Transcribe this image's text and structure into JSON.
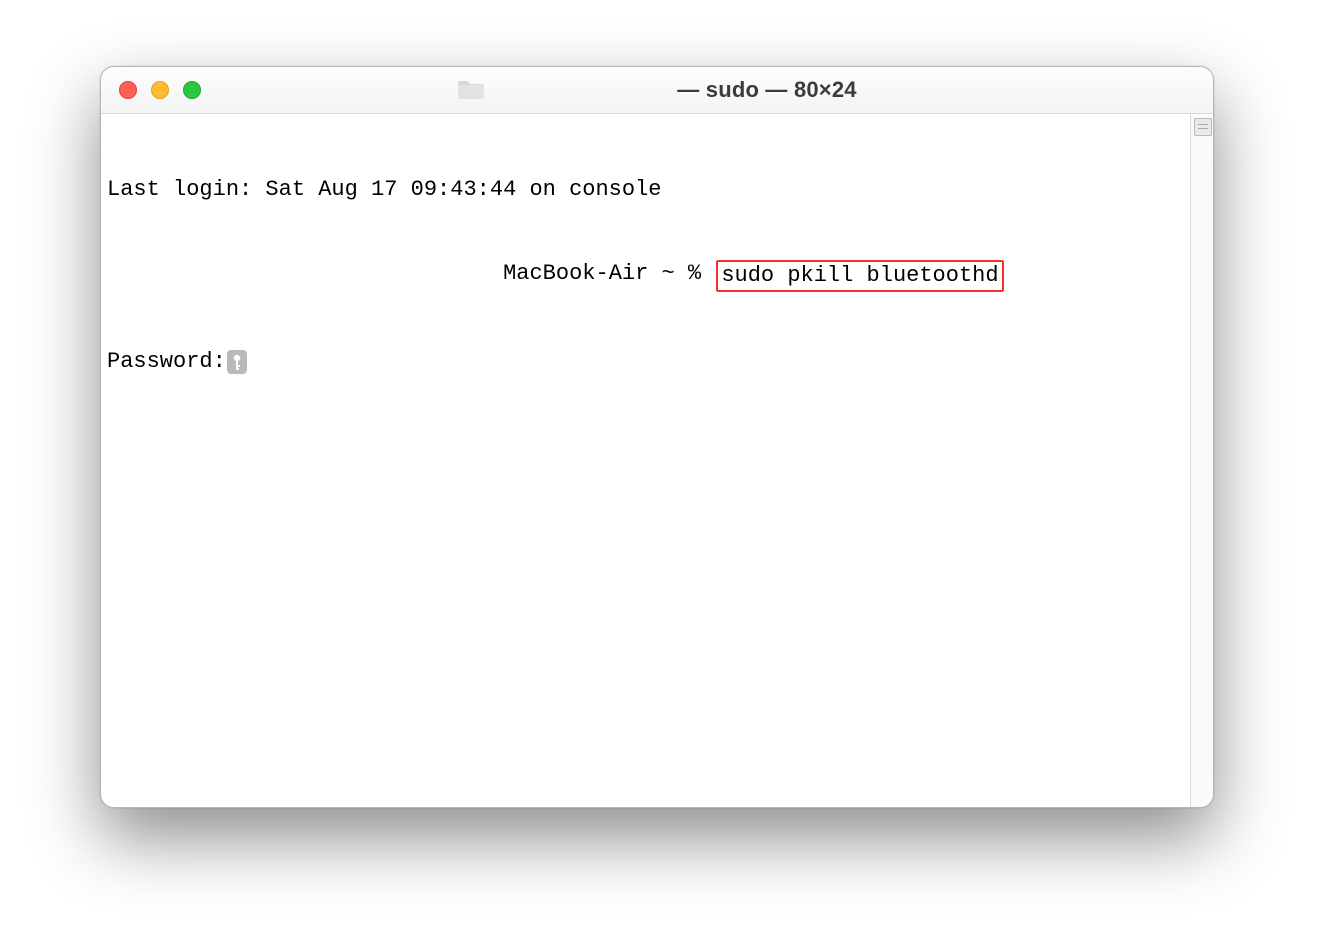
{
  "window": {
    "title": "— sudo — 80×24"
  },
  "terminal": {
    "last_login": "Last login: Sat Aug 17 09:43:44 on console",
    "prompt_host": "MacBook-Air ~ % ",
    "command": "sudo pkill bluetoothd",
    "password_label": "Password:"
  }
}
